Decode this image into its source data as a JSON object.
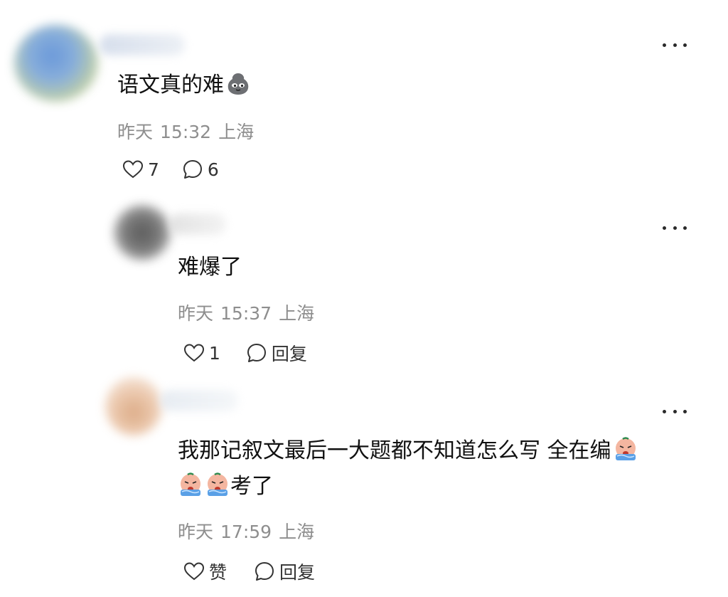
{
  "colors": {
    "text": "#111111",
    "meta": "#8e8e8e",
    "icon": "#333333"
  },
  "comments": [
    {
      "text": "语文真的难",
      "emoji": "smug-face-emoji",
      "date": "昨天",
      "time": "15:32",
      "location": "上海",
      "like_count": "7",
      "reply_label": "6"
    },
    {
      "text": "难爆了",
      "date": "昨天",
      "time": "15:37",
      "location": "上海",
      "like_count": "1",
      "reply_label": "回复"
    },
    {
      "text_line1": "我那记叙文最后一大题都不知道怎么写 全在编",
      "text_line2": "考了",
      "emoji": "crying-face-emoji",
      "date": "昨天",
      "time": "17:59",
      "location": "上海",
      "like_label": "赞",
      "reply_label": "回复"
    }
  ]
}
